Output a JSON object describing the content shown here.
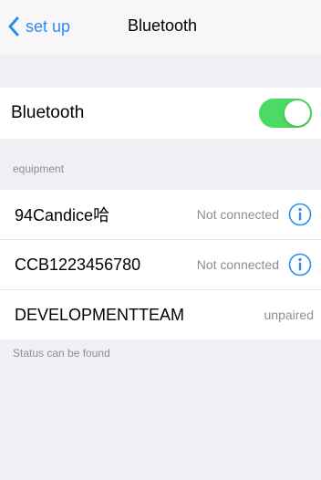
{
  "nav": {
    "back_label": "set up",
    "title": "Bluetooth"
  },
  "bluetooth": {
    "label": "Bluetooth",
    "enabled": true
  },
  "section_header": "equipment",
  "devices": [
    {
      "name": "94Candice哈",
      "status": "Not connected"
    },
    {
      "name": "CCB1223456780",
      "status": "Not connected"
    },
    {
      "name": "DEVELOPMENTTEAM",
      "status": "unpaired"
    }
  ],
  "footer_text": "Status can be found",
  "colors": {
    "accent": "#2d8cf0",
    "toggle_on": "#4cd964",
    "background": "#efeff4"
  },
  "icons": {
    "back": "chevron-left-icon",
    "info": "info-circle-icon"
  }
}
